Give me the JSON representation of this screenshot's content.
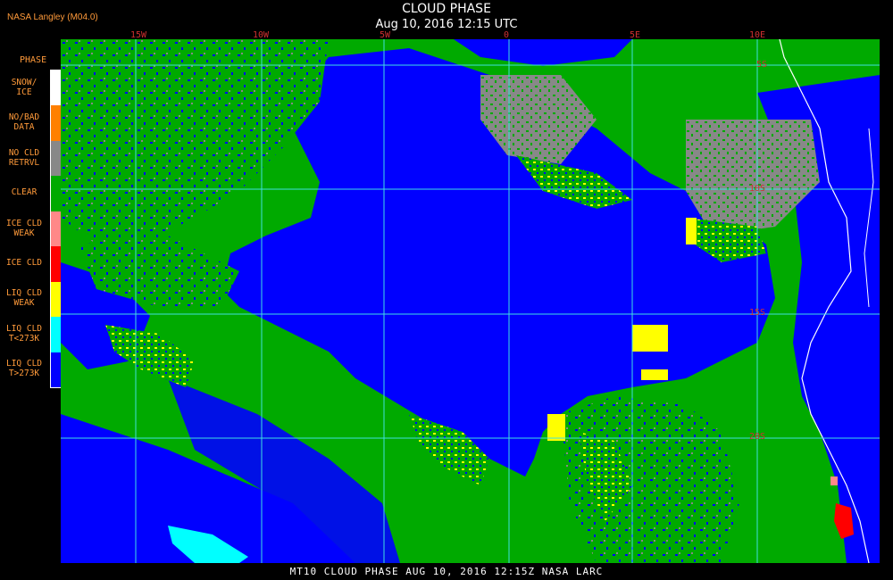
{
  "header": {
    "title": "CLOUD PHASE",
    "subtitle": "Aug 10, 2016 12:15 UTC",
    "source": "NASA Langley (M04.0)"
  },
  "legend": {
    "heading": "PHASE",
    "items": [
      {
        "label_line1": "SNOW/",
        "label_line2": "ICE",
        "color": "#ffffff"
      },
      {
        "label_line1": "NO/BAD",
        "label_line2": "DATA",
        "color": "#ff8000"
      },
      {
        "label_line1": "NO CLD",
        "label_line2": "RETRVL",
        "color": "#888888"
      },
      {
        "label_line1": "CLEAR",
        "label_line2": "",
        "color": "#00aa00"
      },
      {
        "label_line1": "ICE CLD",
        "label_line2": "WEAK",
        "color": "#ff8888"
      },
      {
        "label_line1": "ICE CLD",
        "label_line2": "",
        "color": "#ff0000"
      },
      {
        "label_line1": "LIQ CLD",
        "label_line2": "WEAK",
        "color": "#ffff00"
      },
      {
        "label_line1": "LIQ CLD",
        "label_line2": "T<273K",
        "color": "#00ffff"
      },
      {
        "label_line1": "LIQ CLD",
        "label_line2": "T>273K",
        "color": "#0000ff"
      }
    ]
  },
  "axes": {
    "longitude_ticks": [
      "15W",
      "10W",
      "5W",
      "0",
      "5E",
      "10E"
    ],
    "latitude_ticks": [
      "5S",
      "10S",
      "15S",
      "20S"
    ]
  },
  "footer": {
    "caption": "MT10  CLOUD PHASE  AUG 10, 2016 12:15Z  NASA LARC"
  },
  "colors": {
    "clear": "#00aa00",
    "liq_warm": "#0000ff",
    "liq_weak": "#ffff00",
    "no_cld": "#888888",
    "liq_cold": "#00ffff",
    "ice": "#ff0000",
    "grid": "#40e0e0",
    "coast": "#ffffff"
  }
}
